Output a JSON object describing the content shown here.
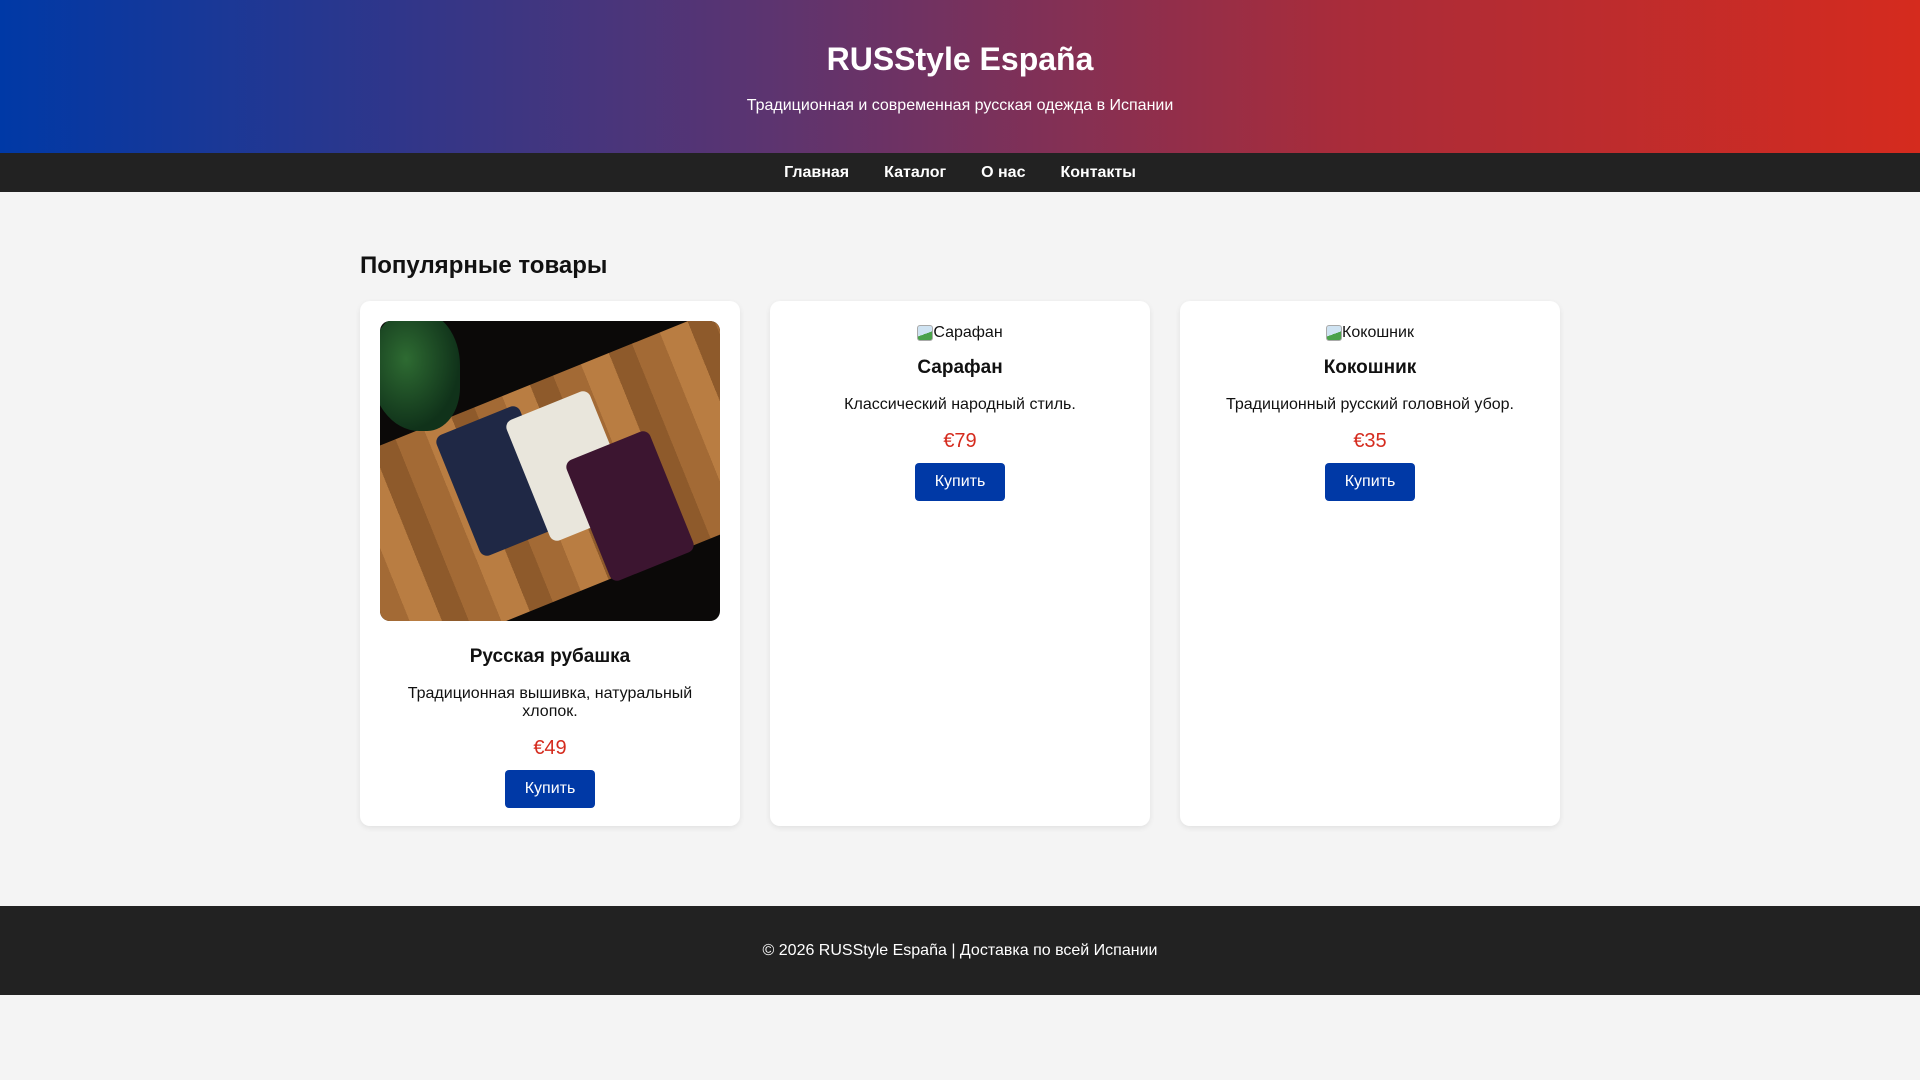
{
  "header": {
    "title": "RUSStyle España",
    "subtitle": "Традиционная и современная русская одежда в Испании"
  },
  "nav": [
    "Главная",
    "Каталог",
    "О нас",
    "Контакты"
  ],
  "section_title": "Популярные товары",
  "products": [
    {
      "name": "Русская рубашка",
      "desc": "Традиционная вышивка, натуральный хлопок.",
      "price": "€49",
      "button": "Купить"
    },
    {
      "name": "Сарафан",
      "alt": "Сарафан",
      "desc": "Классический народный стиль.",
      "price": "€79",
      "button": "Купить"
    },
    {
      "name": "Кокошник",
      "alt": "Кокошник",
      "desc": "Традиционный русский головной убор.",
      "price": "€35",
      "button": "Купить"
    }
  ],
  "footer": "© 2026 RUSStyle España | Доставка по всей Испании",
  "colors": {
    "blue": "#0039a6",
    "red": "#d52b1e",
    "dark": "#222222"
  }
}
